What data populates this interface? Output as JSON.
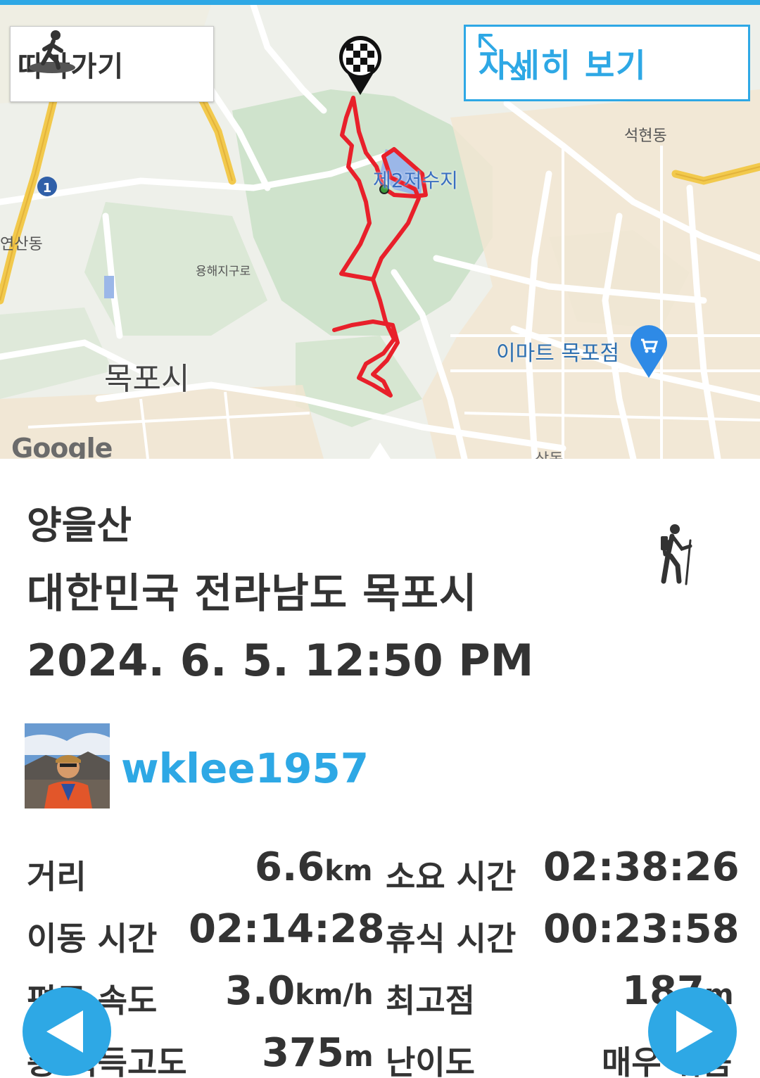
{
  "map": {
    "follow_label": "따라가기",
    "detail_label": "자세히 보기",
    "labels": {
      "city": "목포시",
      "emart": "이마트 목포점",
      "reservoir": "제2저수지",
      "seokhyeon": "석현동",
      "sangdong": "상동",
      "yeonsan": "연산동",
      "yongdang": "용해지구로",
      "google": "Google"
    },
    "route_color": "#e8202a"
  },
  "trail": {
    "name": "양을산",
    "location": "대한민국 전라남도 목포시",
    "datetime": "2024. 6. 5. 12:50 PM",
    "activity_icon": "hiker-icon"
  },
  "user": {
    "username": "wklee1957"
  },
  "stats": {
    "distance_label": "거리",
    "distance_value": "6.6",
    "distance_unit": "km",
    "duration_label": "소요 시간",
    "duration_value": "02:38:26",
    "moving_label": "이동 시간",
    "moving_value": "02:14:28",
    "rest_label": "휴식 시간",
    "rest_value": "00:23:58",
    "speed_label": "평균 속도",
    "speed_value": "3.0",
    "speed_unit": "km/h",
    "max_alt_label": "최고점",
    "max_alt_value": "187",
    "max_alt_unit": "m",
    "climb_label": "총 획득고도",
    "climb_value": "375",
    "climb_unit": "m",
    "difficulty_label": "난이도",
    "difficulty_value": "매우 쉬움"
  },
  "colors": {
    "accent": "#2ea8e5",
    "text": "#333333"
  }
}
